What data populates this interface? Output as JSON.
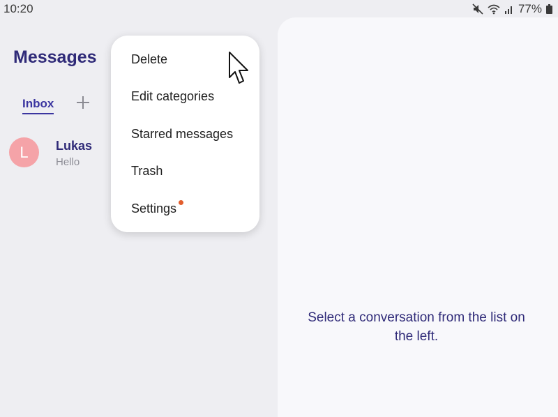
{
  "status_bar": {
    "time": "10:20",
    "battery_percent": "77%",
    "icons": [
      "mute-icon",
      "wifi-icon",
      "signal-icon",
      "battery-icon"
    ]
  },
  "app": {
    "title": "Messages"
  },
  "tabs": [
    {
      "label": "Inbox",
      "selected": true
    }
  ],
  "add_tab_icon": "plus-icon",
  "conversations": [
    {
      "avatar_letter": "L",
      "name": "Lukas",
      "preview": "Hello",
      "avatar_color": "#f5a3a8"
    }
  ],
  "menu": {
    "items": [
      {
        "label": "Delete"
      },
      {
        "label": "Edit categories"
      },
      {
        "label": "Starred messages"
      },
      {
        "label": "Trash"
      },
      {
        "label": "Settings",
        "has_badge": true
      }
    ]
  },
  "detail": {
    "empty_text": "Select a conversation from the list on the left."
  },
  "colors": {
    "accent": "#2f2a78",
    "tab_accent": "#3b35a0",
    "badge": "#e25d2c",
    "background": "#eeeef2",
    "pane": "#f8f8fb"
  }
}
